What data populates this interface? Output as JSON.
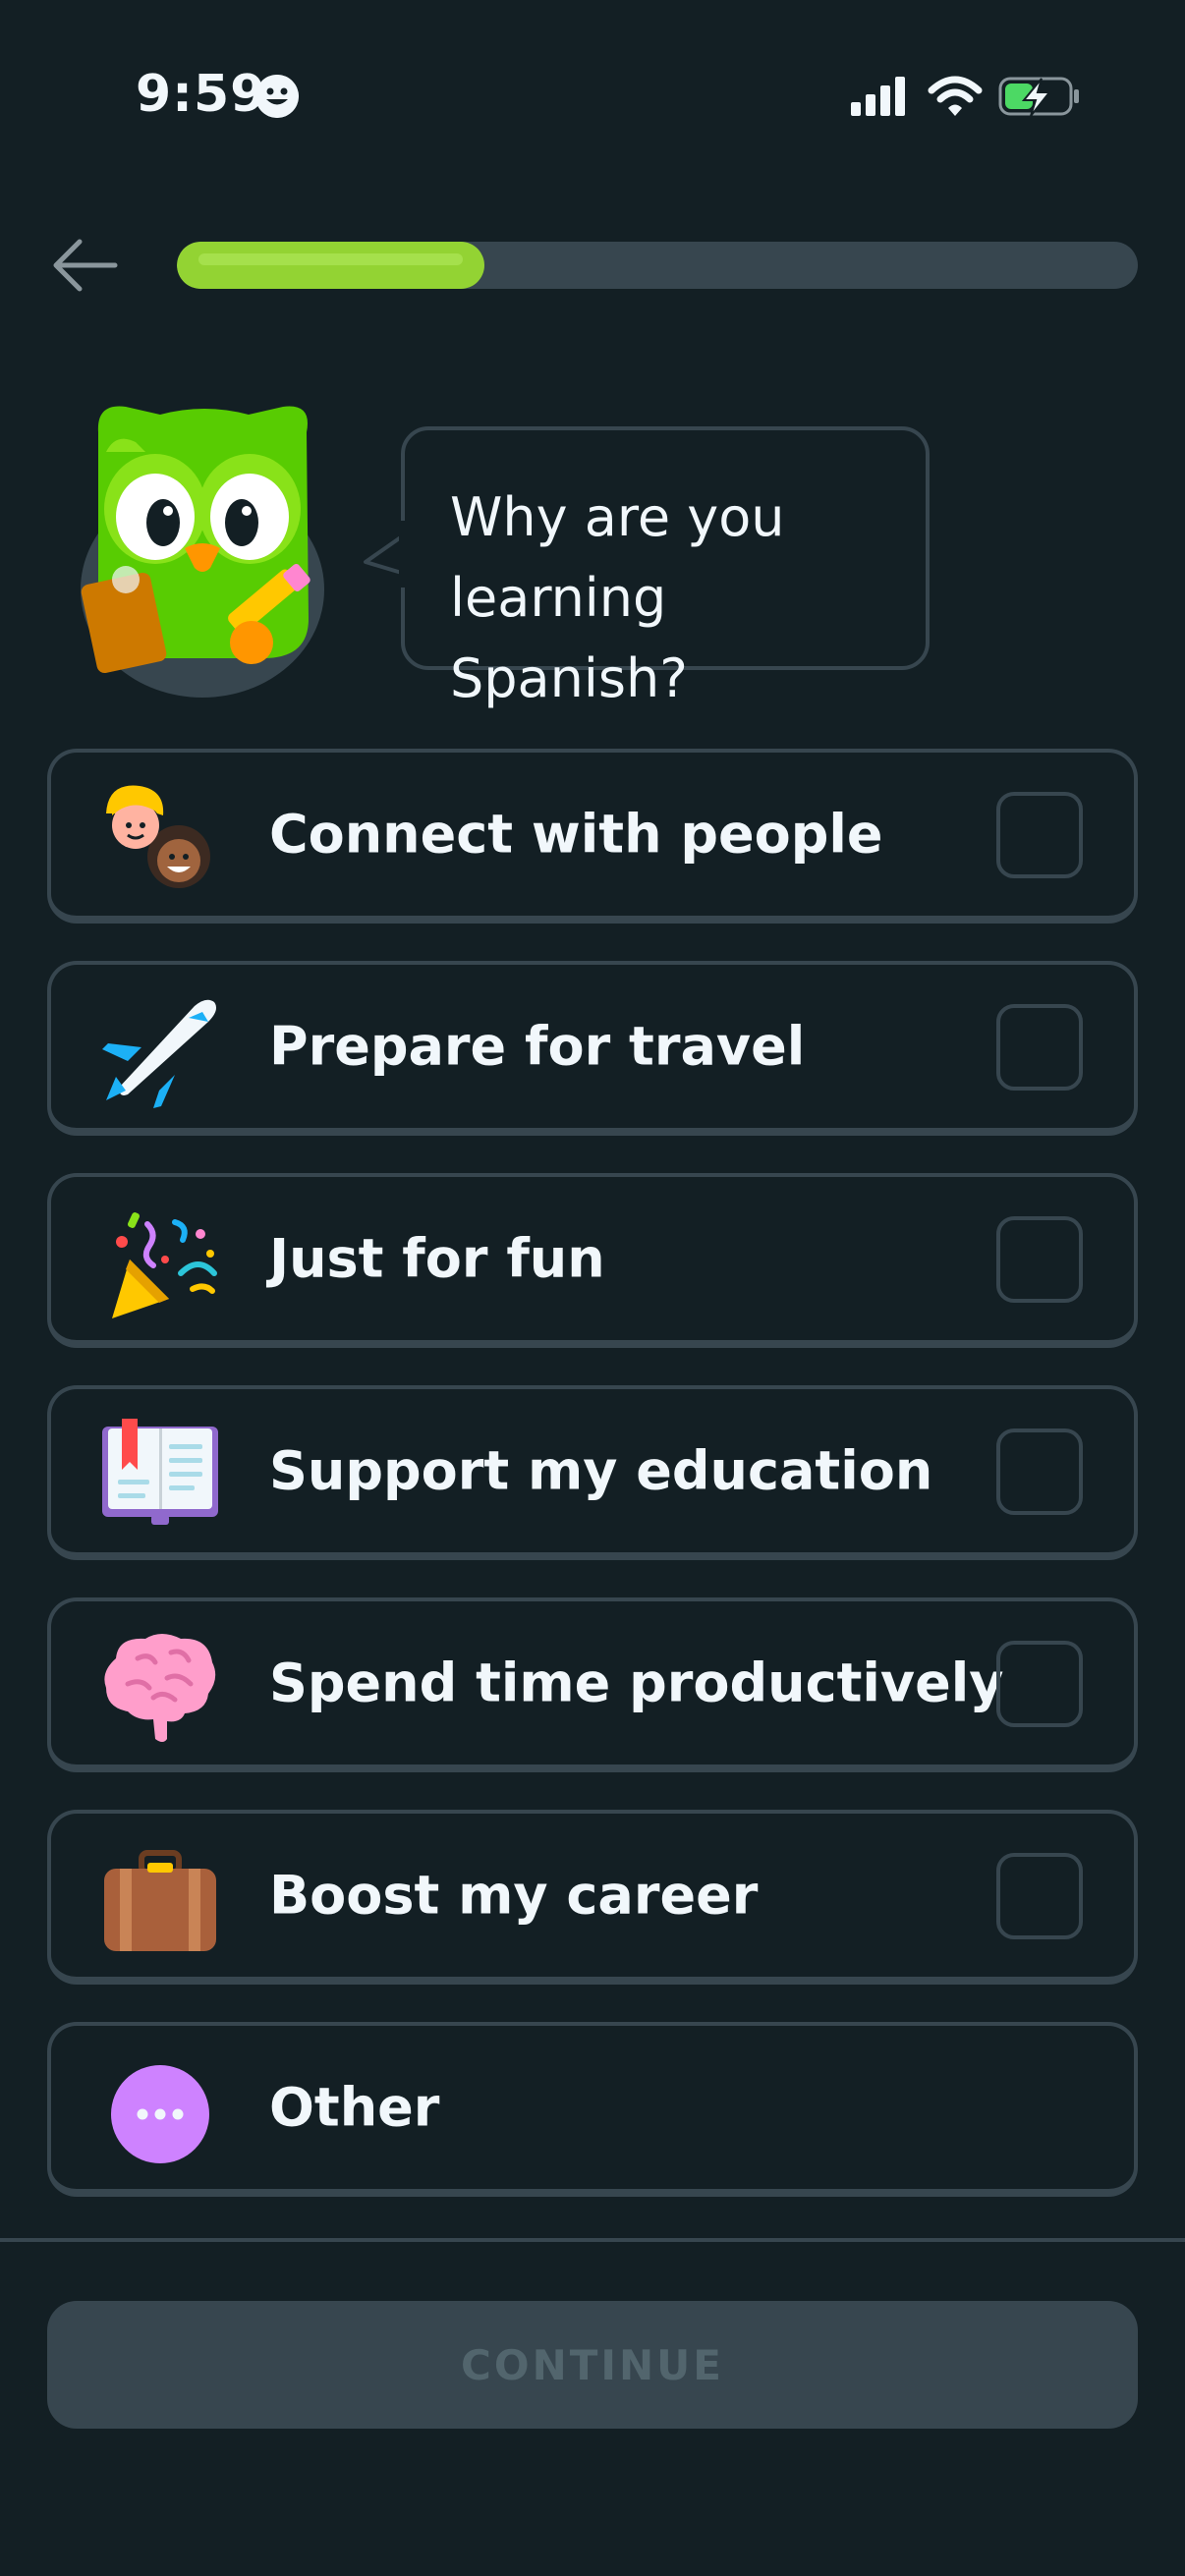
{
  "status_bar": {
    "time": "9:59",
    "icons": [
      "face-badge-icon",
      "cellular-signal-icon",
      "wifi-icon",
      "battery-charging-icon"
    ],
    "battery_color": "#4cd964"
  },
  "header": {
    "back_icon": "arrow-left-icon",
    "progress_fraction": 0.32,
    "progress_color": "#93d333"
  },
  "prompt": {
    "question": "Why are you learning Spanish?"
  },
  "options": [
    {
      "label": "Connect with people",
      "icon": "people-icon",
      "has_checkbox": true,
      "checked": false
    },
    {
      "label": "Prepare for travel",
      "icon": "airplane-icon",
      "has_checkbox": true,
      "checked": false
    },
    {
      "label": "Just for fun",
      "icon": "party-popper-icon",
      "has_checkbox": true,
      "checked": false
    },
    {
      "label": "Support my education",
      "icon": "open-book-icon",
      "has_checkbox": true,
      "checked": false
    },
    {
      "label": "Spend time productively",
      "icon": "brain-icon",
      "has_checkbox": true,
      "checked": false
    },
    {
      "label": "Boost my career",
      "icon": "briefcase-icon",
      "has_checkbox": true,
      "checked": false
    },
    {
      "label": "Other",
      "icon": "more-dots-icon",
      "has_checkbox": false,
      "checked": false
    }
  ],
  "footer": {
    "continue_label": "CONTINUE",
    "continue_enabled": false
  },
  "colors": {
    "background": "#131f24",
    "border": "#37464f",
    "text": "#f1f7fb",
    "accent_green": "#93d333",
    "disabled_text": "#52656d"
  }
}
